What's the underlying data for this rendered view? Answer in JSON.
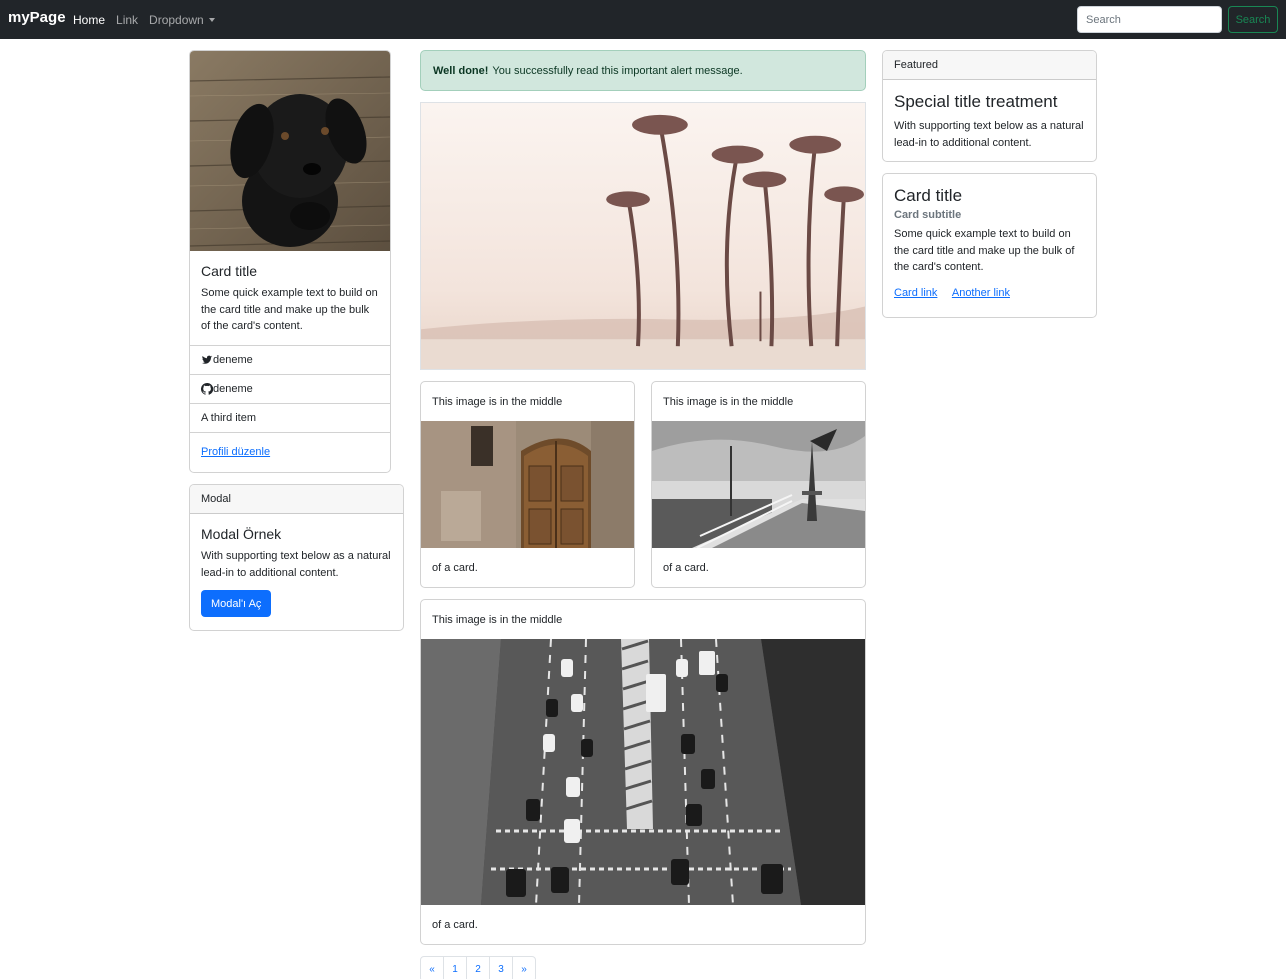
{
  "navbar": {
    "brand": "myPage",
    "links": [
      "Home",
      "Link",
      "Dropdown"
    ],
    "search_placeholder": "Search",
    "search_button": "Search"
  },
  "profile_card": {
    "image": "black-puppy-photo",
    "title": "Card title",
    "text": "Some quick example text to build on the card title and make up the bulk of the card's content.",
    "items": [
      {
        "icon": "twitter-icon",
        "label": "deneme"
      },
      {
        "icon": "github-icon",
        "label": "deneme"
      },
      {
        "icon": "",
        "label": "A third item"
      }
    ],
    "link": "Profili düzenle"
  },
  "modal_card": {
    "header": "Modal",
    "title": "Modal Örnek",
    "text": "With supporting text below as a natural lead-in to additional content.",
    "button": "Modal'ı Aç"
  },
  "alert": {
    "strong": "Well done!",
    "text": "You successfully read this important alert message."
  },
  "hero_image": "palm-trees-beach-photo",
  "image_cards": [
    {
      "header": "This image is in the middle",
      "image": "old-wooden-door-photo",
      "footer": "of a card."
    },
    {
      "header": "This image is in the middle",
      "image": "pier-lighthouse-photo",
      "footer": "of a card."
    },
    {
      "header": "This image is in the middle",
      "image": "city-traffic-road-photo",
      "footer": "of a card."
    }
  ],
  "pagination": [
    "«",
    "1",
    "2",
    "3",
    "»"
  ],
  "featured_card": {
    "header": "Featured",
    "title": "Special title treatment",
    "text": "With supporting text below as a natural lead-in to additional content."
  },
  "subtitle_card": {
    "title": "Card title",
    "subtitle": "Card subtitle",
    "text": "Some quick example text to build on the card title and make up the bulk of the card's content.",
    "links": [
      "Card link",
      "Another link"
    ]
  },
  "colors": {
    "navbar_bg": "#212529",
    "primary": "#0d6efd",
    "success": "#198754",
    "alert_bg": "#d1e7dd"
  }
}
